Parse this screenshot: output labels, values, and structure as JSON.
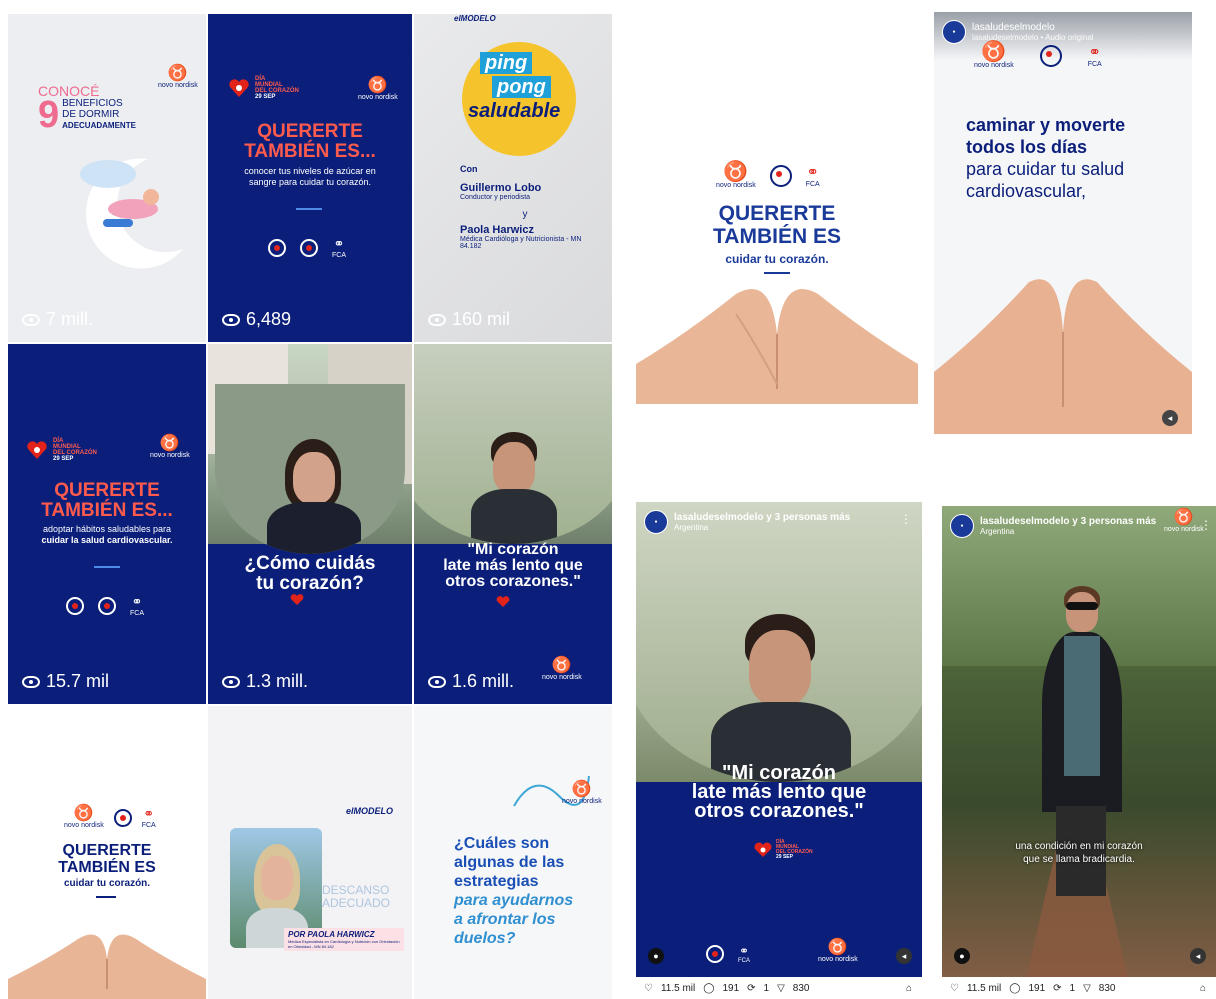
{
  "grid": {
    "t1": {
      "pre": "CONOCÉ",
      "number": "9",
      "line1": "BENEFICIOS",
      "line2": "DE DORMIR",
      "line3": "ADECUADAMENTE",
      "views": "7 mill.",
      "brand": "novo nordisk"
    },
    "t2": {
      "event1": "DÍA",
      "event2": "MUNDIAL",
      "event3": "DEL CORAZÓN",
      "date": "29 SEP",
      "h1": "QUERERTE",
      "h2": "TAMBIÉN ES...",
      "sub": "conocer tus niveles de azúcar en sangre para cuidar tu corazón.",
      "views": "6,489",
      "brand": "novo nordisk",
      "fca": "FCA"
    },
    "t3": {
      "top": "elMODELO",
      "p1": "ping",
      "p2": "pong",
      "p3": "saludable",
      "con": "Con",
      "name1": "Guillermo Lobo",
      "role1": "Conductor y periodista",
      "y": "y",
      "name2": "Paola Harwicz",
      "role2": "Médica Cardióloga y Nutricionista - MN 84.182",
      "views": "160 mil"
    },
    "t4": {
      "event1": "DÍA",
      "event2": "MUNDIAL",
      "event3": "DEL CORAZÓN",
      "date": "29 SEP",
      "h1": "QUERERTE",
      "h2": "TAMBIÉN ES...",
      "sub1": "adoptar hábitos saludables para",
      "sub2": "cuidar la salud cardiovascular.",
      "views": "15.7 mil",
      "brand": "novo nordisk",
      "fca": "FCA"
    },
    "t5": {
      "q1": "¿Cómo cuidás",
      "q2": "tu corazón?",
      "views": "1.3 mill."
    },
    "t6": {
      "q1": "\"Mi corazón",
      "q2": "late más lento que",
      "q3": "otros corazones.\"",
      "views": "1.6 mill.",
      "brand": "novo nordisk"
    },
    "t7": {
      "h1": "QUERERTE",
      "h2": "TAMBIÉN ES",
      "sub": "cuidar tu corazón.",
      "brand": "novo nordisk",
      "fca": "FCA"
    },
    "t8": {
      "top": "elMODELO",
      "title1": "DESCANSO",
      "title2": "ADECUADO",
      "by": "POR PAOLA HARWICZ",
      "cred": "Médica Especialista en Cardiología y Nutrición con Orientación en Obesidad - MN 84.182"
    },
    "t9": {
      "q1": "¿Cuáles son",
      "q2": "algunas de las",
      "q3": "estrategias",
      "q4": "para ayudarnos",
      "q5": "a afrontar los",
      "q6": "duelos?",
      "brand": "novo nordisk"
    }
  },
  "stories": {
    "s1": {
      "brand": "novo nordisk",
      "fca": "FCA",
      "h1": "QUERERTE",
      "h2": "TAMBIÉN ES",
      "sub": "cuidar tu corazón."
    },
    "s2": {
      "user": "lasaludeselmodelo",
      "audio": "lasaludeselmodelo • Audio original",
      "brand": "novo nordisk",
      "fca": "FCA",
      "l1": "caminar y moverte",
      "l2": "todos los días",
      "l3": "para cuidar tu salud",
      "l4": "cardiovascular,"
    },
    "s3": {
      "user": "lasaludeselmodelo y 3 personas más",
      "loc": "Argentina",
      "q1": "\"Mi corazón",
      "q2": "late más lento que",
      "q3": "otros corazones.\"",
      "event1": "DÍA",
      "event2": "MUNDIAL",
      "event3": "DEL CORAZÓN",
      "date": "29 SEP",
      "brand": "novo nordisk",
      "fca": "FCA",
      "likes": "11.5 mil",
      "comments": "191",
      "reposts": "1",
      "shares": "830"
    },
    "s4": {
      "user": "lasaludeselmodelo y 3 personas más",
      "loc": "Argentina",
      "brand": "novo nordisk",
      "caption1": "una condición en mi corazón",
      "caption2": "que se llama bradicardia.",
      "likes": "11.5 mil",
      "comments": "191",
      "reposts": "1",
      "shares": "830"
    }
  }
}
